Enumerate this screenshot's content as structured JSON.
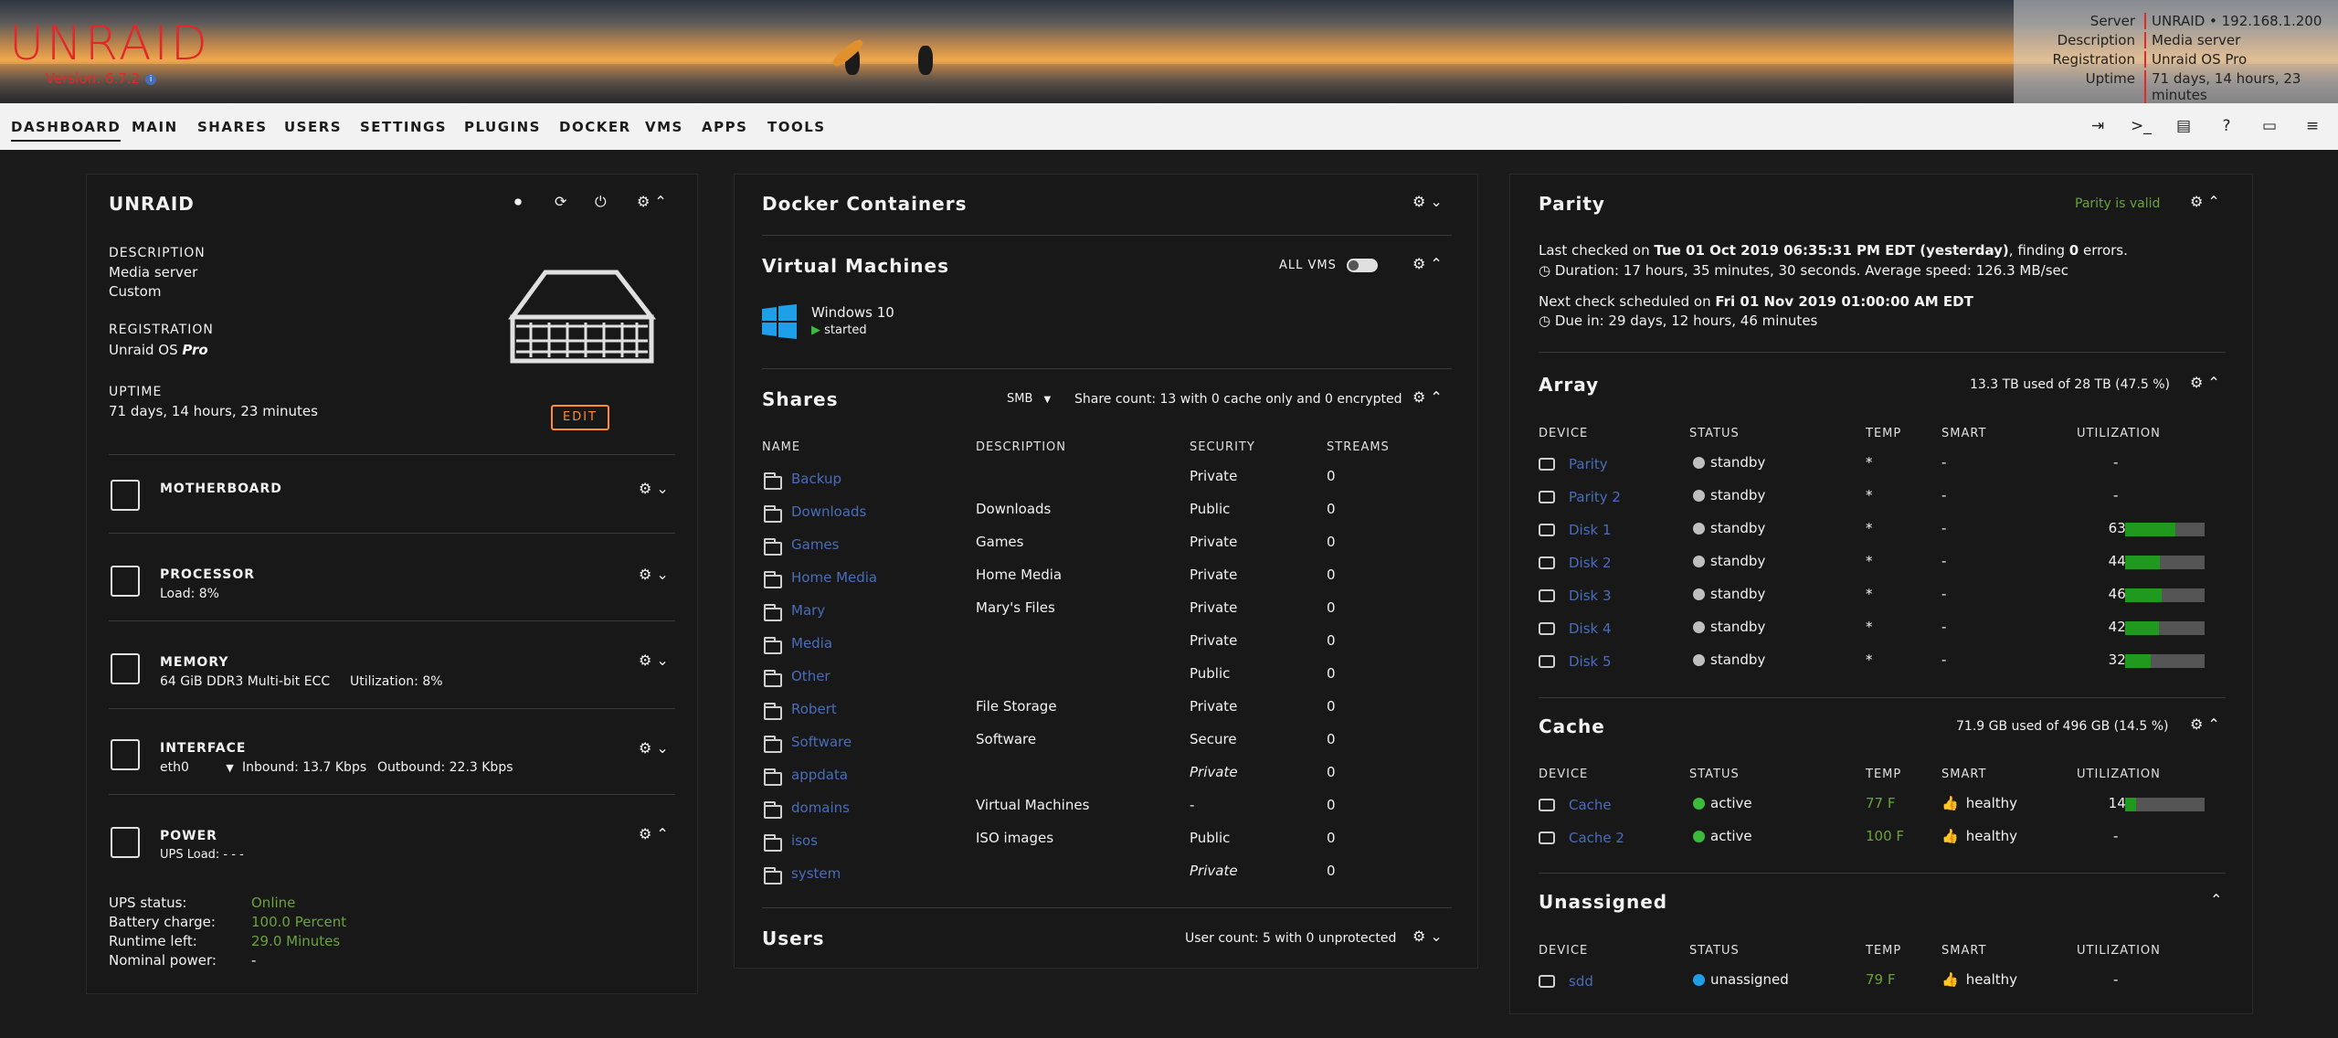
{
  "header": {
    "logo": "UNRAID",
    "version": "Version: 6.7.2",
    "server_info": [
      {
        "key": "Server",
        "value": "UNRAID • 192.168.1.200"
      },
      {
        "key": "Description",
        "value": "Media server"
      },
      {
        "key": "Registration",
        "value": "Unraid OS Pro"
      },
      {
        "key": "Uptime",
        "value": "71 days, 14 hours, 23 minutes"
      }
    ]
  },
  "nav": {
    "items": [
      "DASHBOARD",
      "MAIN",
      "SHARES",
      "USERS",
      "SETTINGS",
      "PLUGINS",
      "DOCKER",
      "VMS",
      "APPS",
      "TOOLS"
    ],
    "right_icons": [
      "logout-icon",
      "terminal-icon",
      "log-icon",
      "help-icon",
      "monitor-icon",
      "notes-icon"
    ]
  },
  "unraid_tile": {
    "title": "UNRAID",
    "description_label": "DESCRIPTION",
    "description_line1": "Media server",
    "description_line2": "Custom",
    "registration_label": "REGISTRATION",
    "registration_value": "Unraid OS",
    "registration_edition": "Pro",
    "uptime_label": "UPTIME",
    "uptime_value": "71 days, 14 hours, 23 minutes",
    "edit_label": "EDIT",
    "sections": {
      "motherboard": {
        "title": "MOTHERBOARD"
      },
      "processor": {
        "title": "PROCESSOR",
        "detail": "Load: 8%"
      },
      "memory": {
        "title": "MEMORY",
        "detail": "64 GiB DDR3 Multi-bit ECC",
        "util": "Utilization: 8%"
      },
      "interface": {
        "title": "INTERFACE",
        "iface": "eth0",
        "inbound": "Inbound: 13.7 Kbps",
        "outbound": "Outbound: 22.3 Kbps"
      },
      "power": {
        "title": "POWER",
        "detail": "UPS Load: - - -",
        "rows": [
          {
            "key": "UPS status:",
            "value": "Online"
          },
          {
            "key": "Battery charge:",
            "value": "100.0 Percent"
          },
          {
            "key": "Runtime left:",
            "value": "29.0 Minutes"
          },
          {
            "key": "Nominal power:",
            "value": "-"
          }
        ]
      }
    }
  },
  "middle": {
    "docker_title": "Docker Containers",
    "vm_title": "Virtual Machines",
    "all_vms_label": "ALL VMS",
    "vm": {
      "name": "Windows 10",
      "state": "started"
    },
    "shares_title": "Shares",
    "shares_protocol": "SMB",
    "share_count": "Share count: 13 with 0 cache only and 0 encrypted",
    "shares_headers": [
      "NAME",
      "DESCRIPTION",
      "SECURITY",
      "STREAMS"
    ],
    "shares": [
      {
        "name": "Backup",
        "description": "",
        "security": "Private",
        "streams": "0",
        "italic": false
      },
      {
        "name": "Downloads",
        "description": "Downloads",
        "security": "Public",
        "streams": "0",
        "italic": false
      },
      {
        "name": "Games",
        "description": "Games",
        "security": "Private",
        "streams": "0",
        "italic": false
      },
      {
        "name": "Home Media",
        "description": "Home Media",
        "security": "Private",
        "streams": "0",
        "italic": false
      },
      {
        "name": "Mary",
        "description": "Mary's Files",
        "security": "Private",
        "streams": "0",
        "italic": false
      },
      {
        "name": "Media",
        "description": "",
        "security": "Private",
        "streams": "0",
        "italic": false
      },
      {
        "name": "Other",
        "description": "",
        "security": "Public",
        "streams": "0",
        "italic": false
      },
      {
        "name": "Robert",
        "description": "File Storage",
        "security": "Private",
        "streams": "0",
        "italic": false
      },
      {
        "name": "Software",
        "description": "Software",
        "security": "Secure",
        "streams": "0",
        "italic": false
      },
      {
        "name": "appdata",
        "description": "",
        "security": "Private",
        "streams": "0",
        "italic": true
      },
      {
        "name": "domains",
        "description": "Virtual Machines",
        "security": "-",
        "streams": "0",
        "italic": false
      },
      {
        "name": "isos",
        "description": "ISO images",
        "security": "Public",
        "streams": "0",
        "italic": false
      },
      {
        "name": "system",
        "description": "",
        "security": "Private",
        "streams": "0",
        "italic": true
      }
    ],
    "users_title": "Users",
    "user_count": "User count: 5 with 0 unprotected"
  },
  "right": {
    "parity_title": "Parity",
    "parity_status": "Parity is valid",
    "last_checked_prefix": "Last checked on ",
    "last_checked_date": "Tue 01 Oct 2019 06:35:31 PM EDT (yesterday)",
    "last_checked_mid": ", finding ",
    "last_checked_errors": "0",
    "last_checked_suffix": " errors.",
    "duration": "Duration: 17 hours, 35 minutes, 30 seconds. Average speed: 126.3 MB/sec",
    "next_check_prefix": "Next check scheduled on ",
    "next_check_date": "Fri 01 Nov 2019 01:00:00 AM EDT",
    "due_in": "Due in: 29 days, 12 hours, 46 minutes",
    "table_headers": [
      "DEVICE",
      "STATUS",
      "TEMP",
      "SMART",
      "UTILIZATION"
    ],
    "array_title": "Array",
    "array_usage": "13.3 TB used of 28 TB (47.5 %)",
    "array": [
      {
        "device": "Parity",
        "status": "standby",
        "temp": "*",
        "smart": "-",
        "util": "-",
        "pct": null
      },
      {
        "device": "Parity 2",
        "status": "standby",
        "temp": "*",
        "smart": "-",
        "util": "-",
        "pct": null
      },
      {
        "device": "Disk 1",
        "status": "standby",
        "temp": "*",
        "smart": "-",
        "util": "63%",
        "pct": 63
      },
      {
        "device": "Disk 2",
        "status": "standby",
        "temp": "*",
        "smart": "-",
        "util": "44%",
        "pct": 44
      },
      {
        "device": "Disk 3",
        "status": "standby",
        "temp": "*",
        "smart": "-",
        "util": "46%",
        "pct": 46
      },
      {
        "device": "Disk 4",
        "status": "standby",
        "temp": "*",
        "smart": "-",
        "util": "42%",
        "pct": 42
      },
      {
        "device": "Disk 5",
        "status": "standby",
        "temp": "*",
        "smart": "-",
        "util": "32%",
        "pct": 32
      }
    ],
    "cache_title": "Cache",
    "cache_usage": "71.9 GB used of 496 GB (14.5 %)",
    "cache": [
      {
        "device": "Cache",
        "status": "active",
        "temp": "77 F",
        "smart": "healthy",
        "util": "14%",
        "pct": 14
      },
      {
        "device": "Cache 2",
        "status": "active",
        "temp": "100 F",
        "smart": "healthy",
        "util": "-",
        "pct": null
      }
    ],
    "unassigned_title": "Unassigned",
    "unassigned": [
      {
        "device": "sdd",
        "status": "unassigned",
        "temp": "79 F",
        "smart": "healthy",
        "util": "-",
        "pct": null
      }
    ]
  },
  "colors": {
    "accent": "#e22828",
    "link": "#486dba",
    "ok": "#6aa33c",
    "warn": "#ff8c2f",
    "bar": "#1f9a1f"
  }
}
